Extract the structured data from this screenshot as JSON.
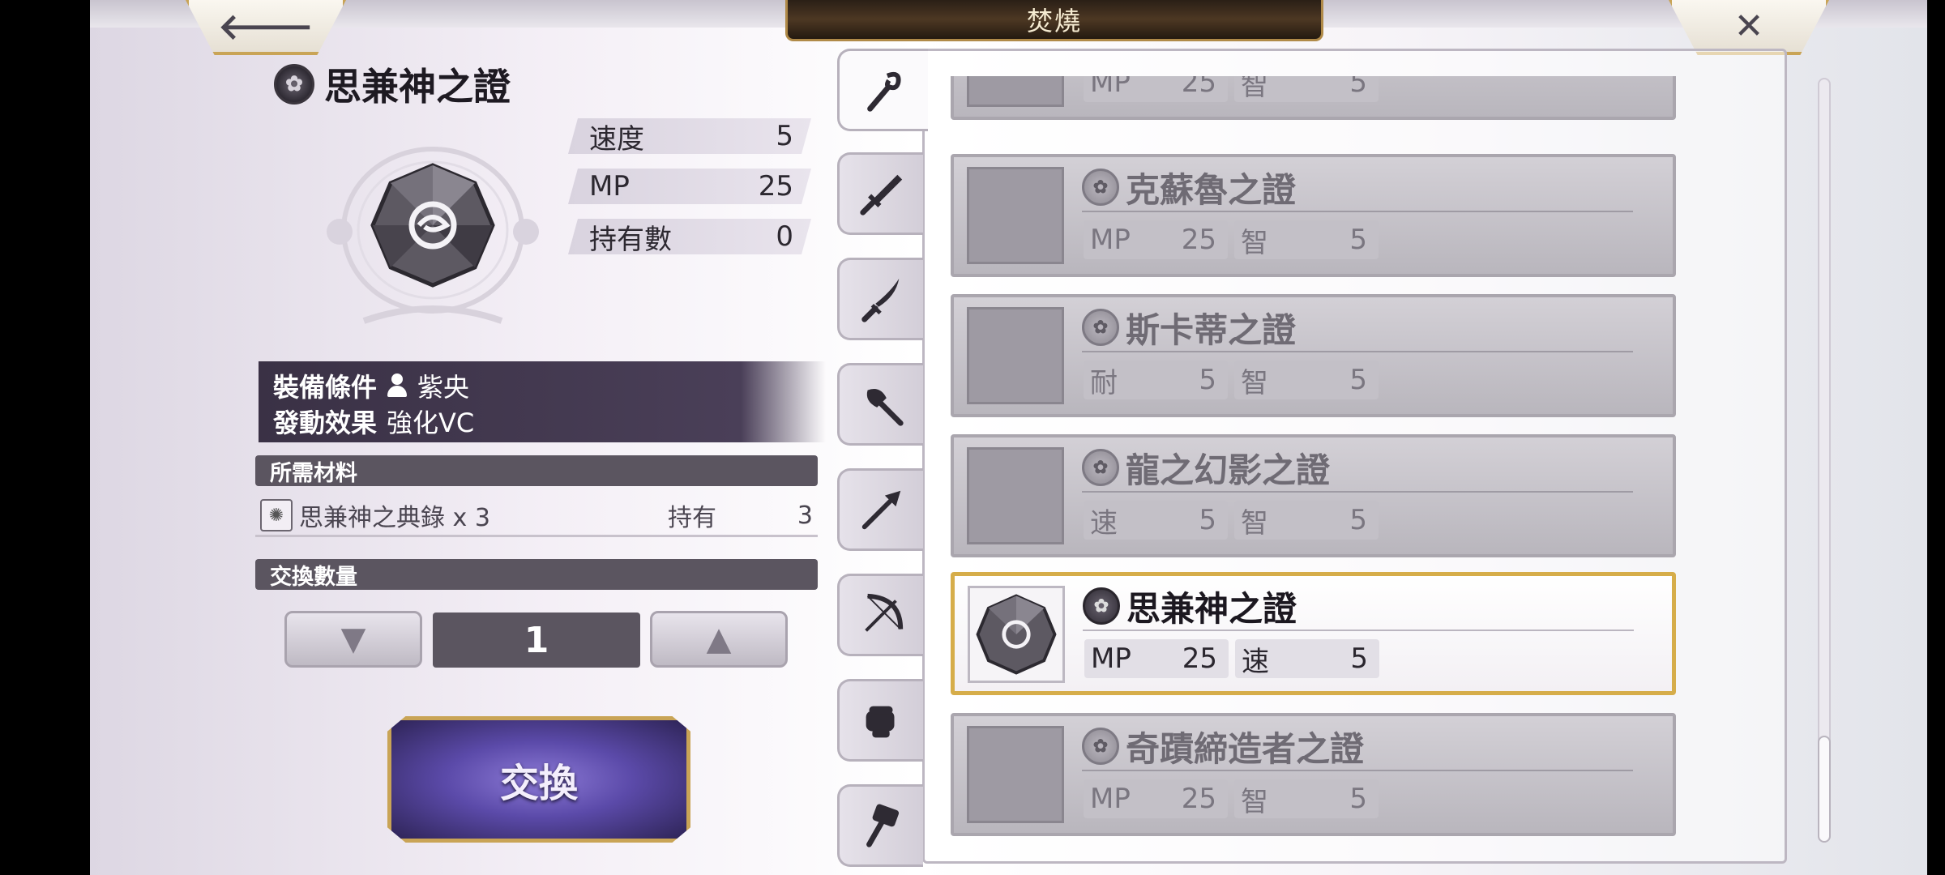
{
  "header": {
    "title": "焚燒",
    "back_glyph": "🡐",
    "close_glyph": "✕"
  },
  "detail": {
    "name": "思兼神之證",
    "badge_glyph": "✿",
    "stats": [
      {
        "label": "速度",
        "value": "5"
      },
      {
        "label": "MP",
        "value": "25"
      },
      {
        "label": "持有數",
        "value": "0"
      }
    ],
    "equip_condition_label": "裝備條件",
    "equip_condition_value": "紫央",
    "effect_label": "發動效果",
    "effect_value": "強化VC"
  },
  "materials": {
    "header": "所需材料",
    "items": [
      {
        "name": "思兼神之典錄 x 3",
        "owned_label": "持有",
        "owned_value": "3",
        "icon": "book-icon",
        "icon_glyph": "✺"
      }
    ]
  },
  "quantity": {
    "header": "交換數量",
    "value": "1",
    "down_glyph": "▼",
    "up_glyph": "▲"
  },
  "exchange_button_label": "交換",
  "tabs": [
    {
      "name": "staff",
      "icon": "staff-icon",
      "active": true
    },
    {
      "name": "sword",
      "icon": "sword-icon",
      "active": false
    },
    {
      "name": "katana",
      "icon": "katana-icon",
      "active": false
    },
    {
      "name": "axe",
      "icon": "axe-icon",
      "active": false
    },
    {
      "name": "spear",
      "icon": "spear-icon",
      "active": false
    },
    {
      "name": "bow",
      "icon": "bow-icon",
      "active": false
    },
    {
      "name": "fist",
      "icon": "fist-icon",
      "active": false
    },
    {
      "name": "hammer",
      "icon": "hammer-icon",
      "active": false
    }
  ],
  "list": [
    {
      "name": "",
      "stat1_label": "MP",
      "stat1_value": "25",
      "stat2_label": "智",
      "stat2_value": "5",
      "selected": false
    },
    {
      "name": "克蘇魯之證",
      "stat1_label": "MP",
      "stat1_value": "25",
      "stat2_label": "智",
      "stat2_value": "5",
      "selected": false
    },
    {
      "name": "斯卡蒂之證",
      "stat1_label": "耐",
      "stat1_value": "5",
      "stat2_label": "智",
      "stat2_value": "5",
      "selected": false
    },
    {
      "name": "龍之幻影之證",
      "stat1_label": "速",
      "stat1_value": "5",
      "stat2_label": "智",
      "stat2_value": "5",
      "selected": false
    },
    {
      "name": "思兼神之證",
      "stat1_label": "MP",
      "stat1_value": "25",
      "stat2_label": "速",
      "stat2_value": "5",
      "selected": true
    },
    {
      "name": "奇蹟締造者之證",
      "stat1_label": "MP",
      "stat1_value": "25",
      "stat2_label": "智",
      "stat2_value": "5",
      "selected": false
    }
  ],
  "colors": {
    "selected_border": "#d6ad4a",
    "panel_dark": "#3a3145",
    "accent_purple": "#5b4aa9"
  }
}
